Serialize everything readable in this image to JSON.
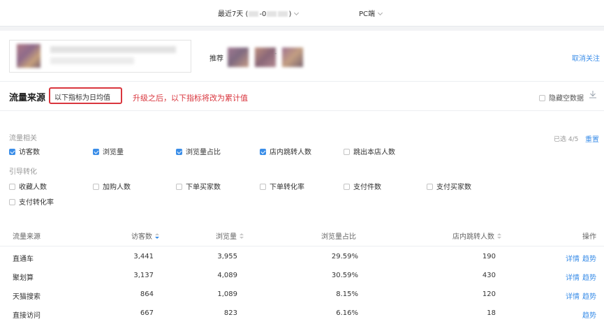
{
  "header": {
    "date_prefix": "最近7天 (",
    "date_mid1": "-0",
    "date_suffix": ")",
    "platform": "PC端"
  },
  "shop": {
    "recommend_label": "推荐",
    "recommend_dash": "-",
    "unfollow": "取消关注"
  },
  "section": {
    "title": "流量来源",
    "mode": "以下指标为日均值",
    "upgrade_note": "升级之后，以下指标将改为累计值",
    "hide_empty": "隐藏空数据"
  },
  "metrics": {
    "group1_label": "流量相关",
    "group2_label": "引导转化",
    "selected_count": "已选 4/5",
    "reset": "重置",
    "items": [
      {
        "label": "访客数",
        "checked": true
      },
      {
        "label": "浏览量",
        "checked": true
      },
      {
        "label": "浏览量占比",
        "checked": true
      },
      {
        "label": "店内跳转人数",
        "checked": true
      },
      {
        "label": "跳出本店人数",
        "checked": false
      },
      {
        "label": "收藏人数",
        "checked": false
      },
      {
        "label": "加购人数",
        "checked": false
      },
      {
        "label": "下单买家数",
        "checked": false
      },
      {
        "label": "下单转化率",
        "checked": false
      },
      {
        "label": "支付件数",
        "checked": false
      },
      {
        "label": "支付买家数",
        "checked": false
      },
      {
        "label": "支付转化率",
        "checked": false
      }
    ]
  },
  "table": {
    "headers": [
      "流量来源",
      "访客数",
      "浏览量",
      "浏览量占比",
      "店内跳转人数",
      "操作"
    ],
    "rows": [
      {
        "source": "直通车",
        "visitors": "3,441",
        "pv": "3,955",
        "ratio": "29.59%",
        "jumps": "190",
        "detail": "详情",
        "trend": "趋势"
      },
      {
        "source": "聚划算",
        "visitors": "3,137",
        "pv": "4,089",
        "ratio": "30.59%",
        "jumps": "430",
        "detail": "详情",
        "trend": "趋势"
      },
      {
        "source": "天猫搜索",
        "visitors": "864",
        "pv": "1,089",
        "ratio": "8.15%",
        "jumps": "120",
        "detail": "详情",
        "trend": "趋势"
      },
      {
        "source": "直接访问",
        "visitors": "667",
        "pv": "823",
        "ratio": "6.16%",
        "jumps": "18",
        "trend": "趋势"
      }
    ]
  }
}
